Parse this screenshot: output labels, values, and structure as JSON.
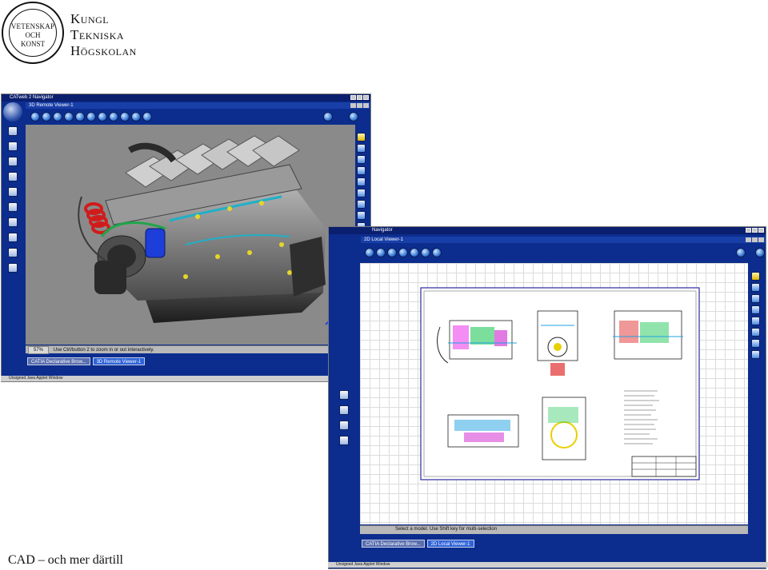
{
  "logo": {
    "seal_line1": "VETENSKAP",
    "seal_line2": "OCH",
    "seal_line3": "KONST",
    "wordmark": [
      "Kungl",
      "Tekniska",
      "Högskolan"
    ]
  },
  "window_3d": {
    "title": "CATweb 2 Navigator",
    "viewer_title": "3D Remote Viewer-1",
    "zoom_percent": "57%",
    "status_text": "Use Ctrl/button 2 to zoom in or out interactively.",
    "tabs": [
      "CATIA Declarative Brow...",
      "3D Remote Viewer-1"
    ],
    "active_tab": 1,
    "badge_text": "CATweb",
    "applet_text": "Unsigned Java Applet Window"
  },
  "window_2d": {
    "title": "Navigator",
    "viewer_title": "2D Local Viewer-1",
    "status_text": "Select a model. Use Shift key for multi-selection",
    "tabs": [
      "CATIA Declarative Brow...",
      "2D Local Viewer-1"
    ],
    "active_tab": 1,
    "applet_text": "Unsigned Java Applet Window"
  },
  "caption": "CAD – och mer därtill",
  "colors": {
    "window_blue": "#0c2d8d",
    "title_blue": "#0a1f6e",
    "viewport_gray": "#8a8a8a",
    "status_gray": "#b9b9b9"
  }
}
